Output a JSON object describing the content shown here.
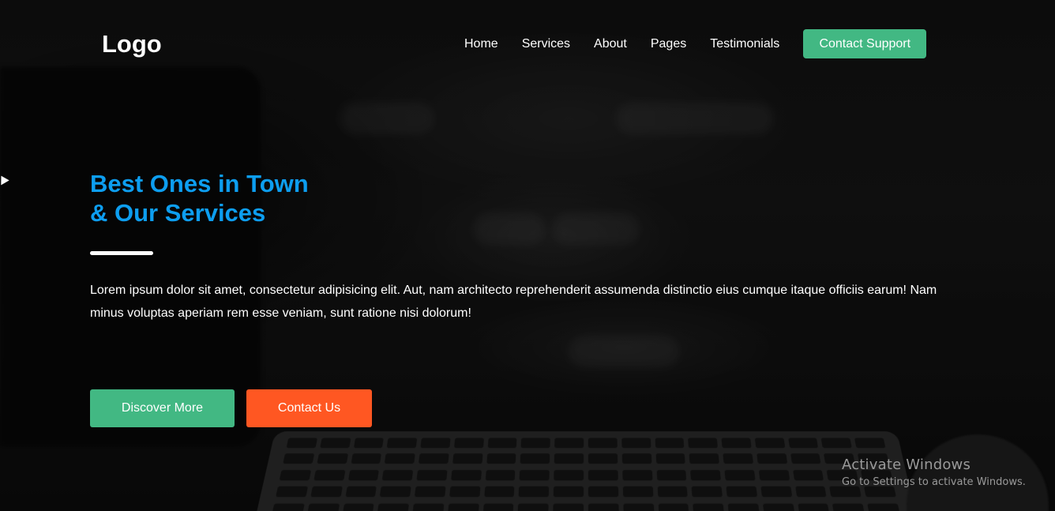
{
  "header": {
    "logo": "Logo",
    "nav": [
      "Home",
      "Services",
      "About",
      "Pages",
      "Testimonials"
    ],
    "cta_label": "Contact Support"
  },
  "hero": {
    "title_line1": "Best Ones in Town",
    "title_line2": "& Our Services",
    "description": "Lorem ipsum dolor sit amet, consectetur adipisicing elit. Aut, nam architecto reprehenderit assumenda distinctio eius cumque itaque officiis earum! Nam minus voluptas aperiam rem esse veniam, sunt ratione nisi dolorum!",
    "primary_button": "Discover More",
    "secondary_button": "Contact Us"
  },
  "watermark": {
    "title": "Activate Windows",
    "subtitle": "Go to Settings to activate Windows."
  },
  "colors": {
    "accent_green": "#42b883",
    "accent_orange": "#ff5722",
    "title_blue": "#0d9ef0"
  }
}
